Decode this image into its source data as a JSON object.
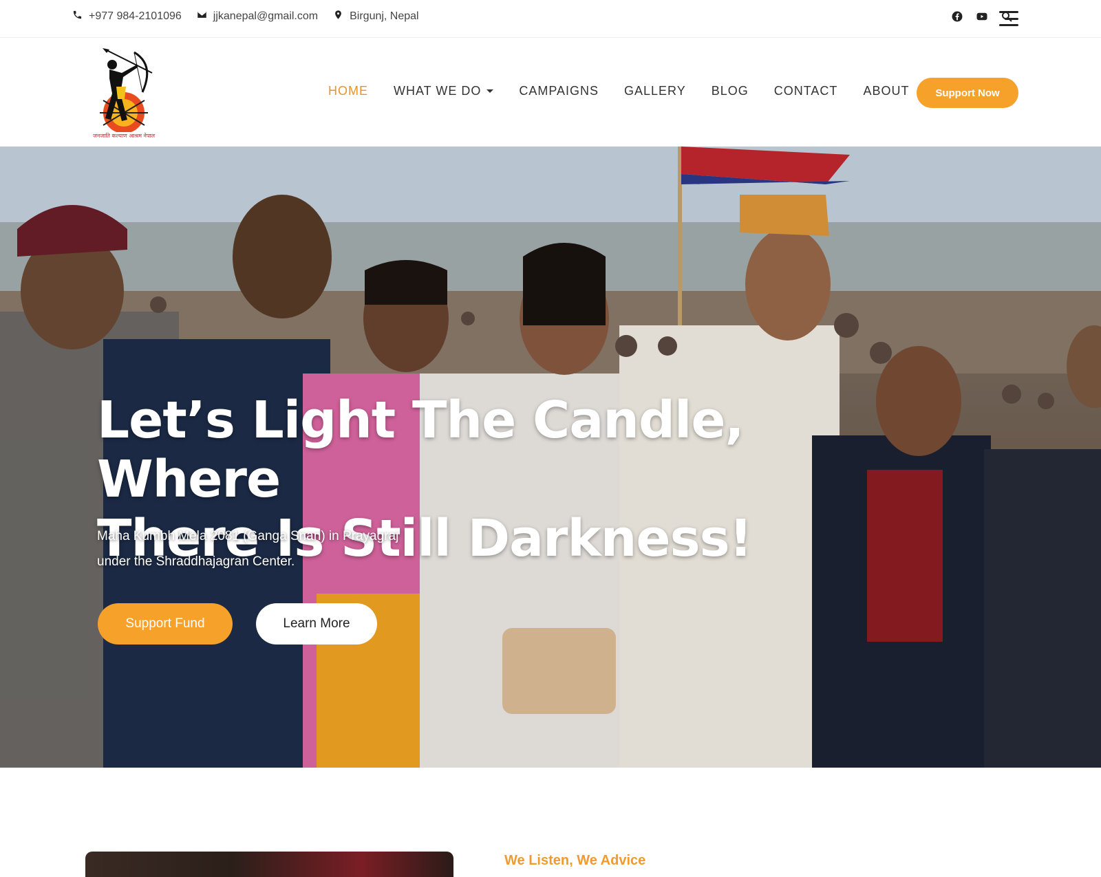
{
  "topbar": {
    "phone": "+977 984-2101096",
    "email": "jjkanepal@gmail.com",
    "location": "Birgunj, Nepal",
    "icons": [
      "phone-icon",
      "envelope-icon",
      "map-marker-icon",
      "facebook-icon",
      "youtube-icon",
      "search-icon",
      "menu-icon"
    ]
  },
  "header": {
    "logo_text": "जनजाति कल्याण आश्रम नेपाल",
    "nav": [
      {
        "label": "HOME",
        "active": true
      },
      {
        "label": "WHAT WE DO",
        "has_dropdown": true
      },
      {
        "label": "CAMPAIGNS"
      },
      {
        "label": "GALLERY"
      },
      {
        "label": "BLOG"
      },
      {
        "label": "CONTACT"
      },
      {
        "label": "ABOUT"
      }
    ],
    "cta_label": "Support Now"
  },
  "hero": {
    "title_line1": "Let’s Light The Candle, Where",
    "title_line2": "There Is Still Darkness!",
    "subtitle_line1": "Maha Kumbh Mela 2081 (Ganga Snan) in Prayagraj",
    "subtitle_line2": "under the Shraddhajagran Center.",
    "primary_button": "Support Fund",
    "secondary_button": "Learn More"
  },
  "section": {
    "tagline": "We Listen, We Advice"
  },
  "colors": {
    "accent": "#f6a12a",
    "nav_active": "#e8912f",
    "text": "#333333"
  }
}
